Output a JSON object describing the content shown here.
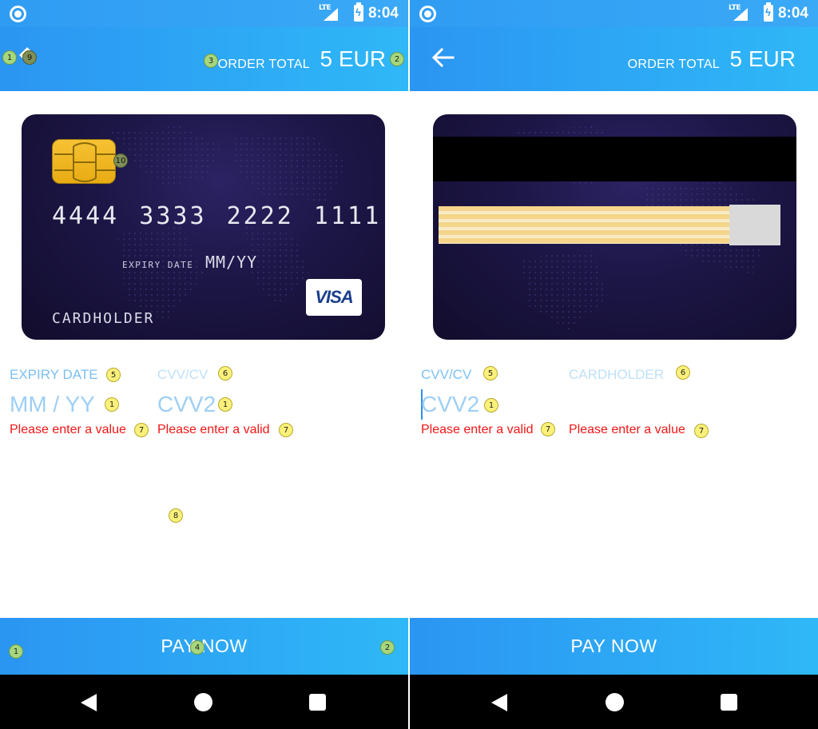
{
  "status_bar": {
    "network": "LTE",
    "time": "8:04"
  },
  "header": {
    "order_label": "ORDER TOTAL",
    "order_amount": "5 EUR",
    "back_icon": "arrow-left-icon"
  },
  "card_front": {
    "number": "4444 3333 2222 1111",
    "expiry_caption": "EXPIRY DATE",
    "expiry_value": "MM/YY",
    "holder": "CARDHOLDER",
    "brand": "VISA"
  },
  "left_form": {
    "field1_label": "EXPIRY DATE",
    "field1_placeholder": "MM / YY",
    "field1_error": "Please enter a value",
    "field2_label": "CVV/CV",
    "field2_placeholder": "CVV2",
    "field2_error": "Please enter a valid"
  },
  "right_form": {
    "field1_label": "CVV/CV",
    "field1_placeholder": "CVV2",
    "field1_error": "Please enter a valid",
    "field2_label": "CARDHOLDER",
    "field2_error": "Please enter a value"
  },
  "pay_button": {
    "label": "PAY NOW"
  },
  "badges": {
    "b1": "1",
    "b2": "2",
    "b3": "3",
    "b4": "4",
    "b5": "5",
    "b6": "6",
    "b7": "7",
    "b8": "8",
    "b9": "9",
    "b10": "10"
  },
  "colors": {
    "accent": "#2f9cf3",
    "error": "#f21616",
    "label": "#7cc0f3",
    "card": "#1c1646"
  }
}
